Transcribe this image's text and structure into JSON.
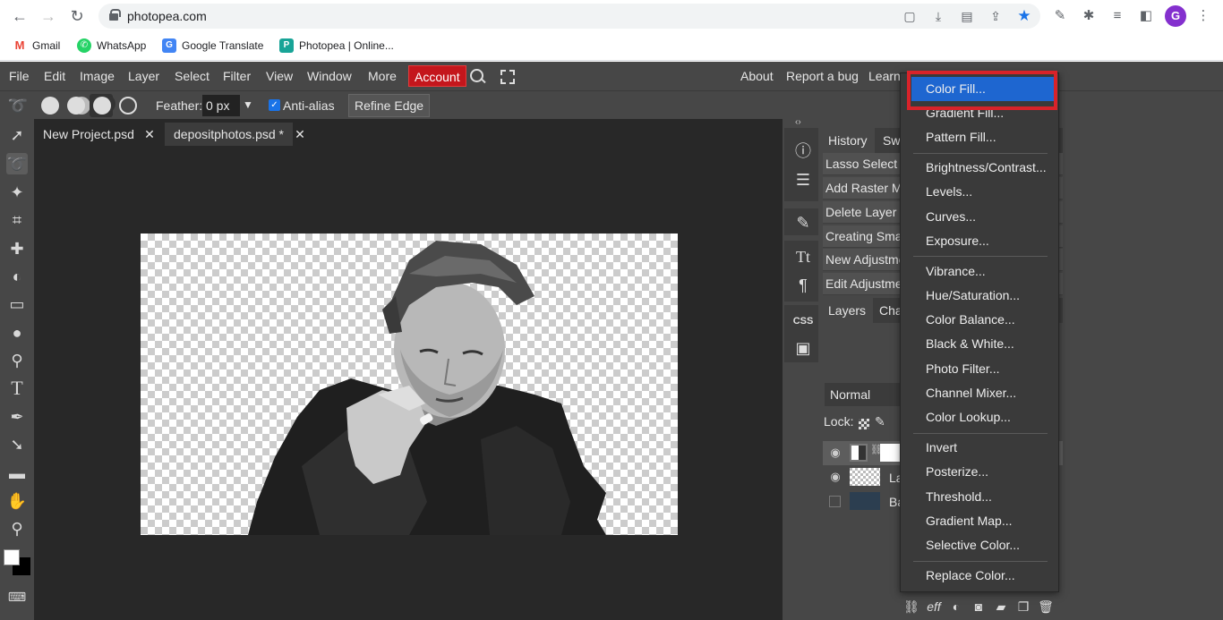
{
  "browser": {
    "url": "photopea.com",
    "bookmarks": [
      {
        "label": "Gmail",
        "icon": "gmail-icon",
        "color": "#ea4335"
      },
      {
        "label": "WhatsApp",
        "icon": "whatsapp-icon",
        "color": "#25d366"
      },
      {
        "label": "Google Translate",
        "icon": "translate-icon",
        "color": "#4285f4"
      },
      {
        "label": "Photopea | Online...",
        "icon": "photopea-icon",
        "color": "#18a497"
      }
    ],
    "profile_initial": "G"
  },
  "menubar": {
    "items": [
      "File",
      "Edit",
      "Image",
      "Layer",
      "Select",
      "Filter",
      "View",
      "Window",
      "More"
    ],
    "account": "Account",
    "right_items": [
      "About",
      "Report a bug",
      "Learn"
    ]
  },
  "options": {
    "feather_label": "Feather:",
    "feather_value": "0 px",
    "antialias_label": "Anti-alias",
    "refine_label": "Refine Edge"
  },
  "doc_tabs": [
    {
      "label": "New Project.psd"
    },
    {
      "label": "depositphotos.psd *"
    }
  ],
  "history": {
    "tabs": [
      "History",
      "Sw"
    ],
    "items": [
      "Lasso Select",
      "Add Raster M",
      "Delete Layer",
      "Creating Sma",
      "New Adjustme",
      "Edit Adjustme"
    ]
  },
  "layers": {
    "tabs": [
      "Layers",
      "Cha"
    ],
    "blend_mode": "Normal",
    "lock_label": "Lock:",
    "rows": [
      {
        "name": ""
      },
      {
        "name": "La"
      },
      {
        "name": "Ba"
      }
    ]
  },
  "dropdown": {
    "groups": [
      [
        "Color Fill...",
        "Gradient Fill...",
        "Pattern Fill..."
      ],
      [
        "Brightness/Contrast...",
        "Levels...",
        "Curves...",
        "Exposure..."
      ],
      [
        "Vibrance...",
        "Hue/Saturation...",
        "Color Balance...",
        "Black & White...",
        "Photo Filter...",
        "Channel Mixer...",
        "Color Lookup..."
      ],
      [
        "Invert",
        "Posterize...",
        "Threshold...",
        "Gradient Map...",
        "Selective Color..."
      ],
      [
        "Replace Color..."
      ]
    ],
    "highlighted": "Color Fill...",
    "highlight_color": "#1e66d0",
    "annotation_color": "#d8232a"
  }
}
